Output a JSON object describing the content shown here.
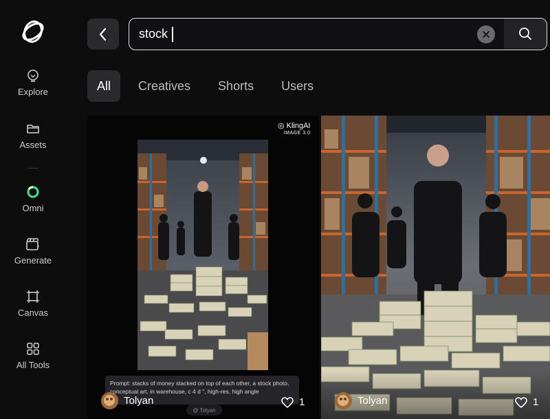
{
  "sidebar": {
    "items": [
      {
        "label": "Explore",
        "icon": "lightbulb-icon"
      },
      {
        "label": "Assets",
        "icon": "folder-icon"
      },
      {
        "label": "Omni",
        "icon": "omni-ring-icon"
      },
      {
        "label": "Generate",
        "icon": "clapper-icon"
      },
      {
        "label": "Canvas",
        "icon": "canvas-frame-icon"
      },
      {
        "label": "All Tools",
        "icon": "grid-icon"
      }
    ]
  },
  "search": {
    "value": "stock"
  },
  "tabs": [
    {
      "label": "All",
      "active": true
    },
    {
      "label": "Creatives"
    },
    {
      "label": "Shorts"
    },
    {
      "label": "Users"
    }
  ],
  "results": [
    {
      "author": "Tolyan",
      "likes": "1",
      "badge_brand": "KlingAI",
      "badge_model": "IMAGE 3.0",
      "prompt": "Prompt: stacks of money stacked on top of each other, a stock photo, conceptual art, in warehouse, c 4 d \", high-res, high angle",
      "watermark": "@ Tolyan"
    },
    {
      "author": "Tolyan",
      "likes": "1"
    }
  ],
  "colors": {
    "accent_green": "#3ddc84",
    "background": "#0d0d0e",
    "tab_active": "#2a2a2d"
  }
}
